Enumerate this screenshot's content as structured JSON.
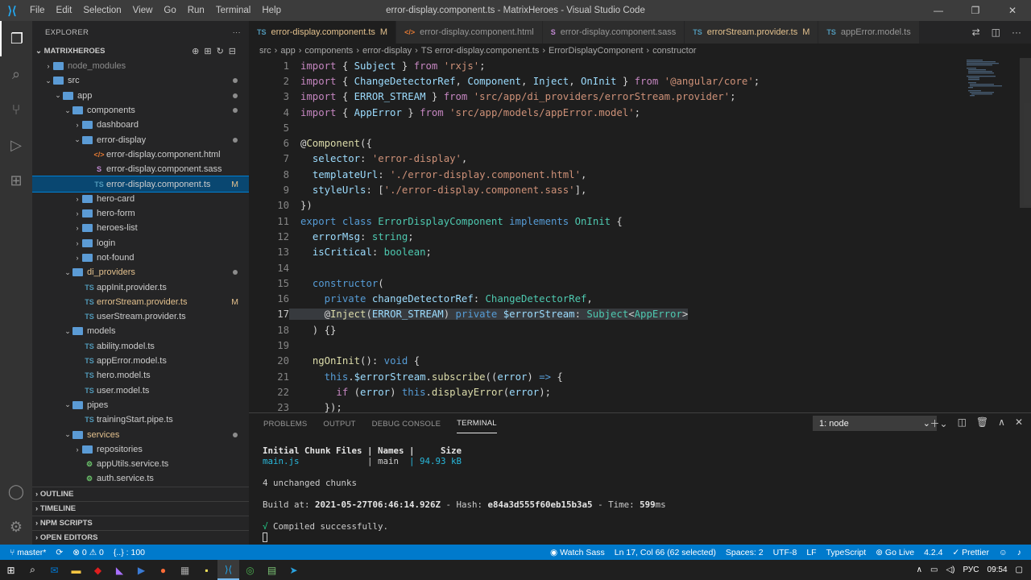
{
  "titlebar": {
    "menu": [
      "File",
      "Edit",
      "Selection",
      "View",
      "Go",
      "Run",
      "Terminal",
      "Help"
    ],
    "title": "error-display.component.ts - MatrixHeroes - Visual Studio Code"
  },
  "activity": [
    "files-icon",
    "search-icon",
    "source-control-icon",
    "run-debug-icon",
    "extensions-icon"
  ],
  "explorer": {
    "header": "EXPLORER",
    "root": "MATRIXHEROES",
    "tree": [
      {
        "label": "node_modules",
        "depth": 1,
        "kind": "folder",
        "open": false,
        "dim": true
      },
      {
        "label": "src",
        "depth": 1,
        "kind": "folder",
        "open": true,
        "dot": true
      },
      {
        "label": "app",
        "depth": 2,
        "kind": "folder",
        "open": true,
        "dot": true
      },
      {
        "label": "components",
        "depth": 3,
        "kind": "folder",
        "open": true,
        "dot": true
      },
      {
        "label": "dashboard",
        "depth": 4,
        "kind": "folder",
        "open": false
      },
      {
        "label": "error-display",
        "depth": 4,
        "kind": "folder",
        "open": true,
        "dot": true
      },
      {
        "label": "error-display.component.html",
        "depth": 5,
        "kind": "html"
      },
      {
        "label": "error-display.component.sass",
        "depth": 5,
        "kind": "sass"
      },
      {
        "label": "error-display.component.ts",
        "depth": 5,
        "kind": "ts",
        "selected": true,
        "mod": "M"
      },
      {
        "label": "hero-card",
        "depth": 4,
        "kind": "folder",
        "open": false
      },
      {
        "label": "hero-form",
        "depth": 4,
        "kind": "folder",
        "open": false
      },
      {
        "label": "heroes-list",
        "depth": 4,
        "kind": "folder",
        "open": false
      },
      {
        "label": "login",
        "depth": 4,
        "kind": "folder",
        "open": false
      },
      {
        "label": "not-found",
        "depth": 4,
        "kind": "folder",
        "open": false
      },
      {
        "label": "di_providers",
        "depth": 3,
        "kind": "folder",
        "open": true,
        "dot": true,
        "modified": true
      },
      {
        "label": "appInit.provider.ts",
        "depth": 4,
        "kind": "ts"
      },
      {
        "label": "errorStream.provider.ts",
        "depth": 4,
        "kind": "ts",
        "mod": "M",
        "modified": true
      },
      {
        "label": "userStream.provider.ts",
        "depth": 4,
        "kind": "ts"
      },
      {
        "label": "models",
        "depth": 3,
        "kind": "folder",
        "open": true
      },
      {
        "label": "ability.model.ts",
        "depth": 4,
        "kind": "ts"
      },
      {
        "label": "appError.model.ts",
        "depth": 4,
        "kind": "ts"
      },
      {
        "label": "hero.model.ts",
        "depth": 4,
        "kind": "ts"
      },
      {
        "label": "user.model.ts",
        "depth": 4,
        "kind": "ts"
      },
      {
        "label": "pipes",
        "depth": 3,
        "kind": "folder",
        "open": true
      },
      {
        "label": "trainingStart.pipe.ts",
        "depth": 4,
        "kind": "ts"
      },
      {
        "label": "services",
        "depth": 3,
        "kind": "folder",
        "open": true,
        "dot": true,
        "modified": true
      },
      {
        "label": "repositories",
        "depth": 4,
        "kind": "folder",
        "open": false
      },
      {
        "label": "appUtils.service.ts",
        "depth": 4,
        "kind": "svc"
      },
      {
        "label": "auth.service.ts",
        "depth": 4,
        "kind": "svc"
      }
    ],
    "sections": [
      "OUTLINE",
      "TIMELINE",
      "NPM SCRIPTS",
      "OPEN EDITORS"
    ]
  },
  "tabs": [
    {
      "icon": "TS",
      "label": "error-display.component.ts",
      "mod": "M",
      "active": true
    },
    {
      "icon": "</>",
      "label": "error-display.component.html"
    },
    {
      "icon": "S",
      "label": "error-display.component.sass"
    },
    {
      "icon": "TS",
      "label": "errorStream.provider.ts",
      "mod": "M"
    },
    {
      "icon": "TS",
      "label": "appError.model.ts"
    }
  ],
  "breadcrumb": [
    "src",
    "app",
    "components",
    "error-display",
    "TS error-display.component.ts",
    "ErrorDisplayComponent",
    "constructor"
  ],
  "code": [
    [
      [
        "kw",
        "import"
      ],
      [
        "p",
        " { "
      ],
      [
        "var",
        "Subject"
      ],
      [
        "p",
        " } "
      ],
      [
        "kw",
        "from"
      ],
      [
        "p",
        " "
      ],
      [
        "str",
        "'rxjs'"
      ],
      [
        "p",
        ";"
      ]
    ],
    [
      [
        "kw",
        "import"
      ],
      [
        "p",
        " { "
      ],
      [
        "var",
        "ChangeDetectorRef"
      ],
      [
        "p",
        ", "
      ],
      [
        "var",
        "Component"
      ],
      [
        "p",
        ", "
      ],
      [
        "var",
        "Inject"
      ],
      [
        "p",
        ", "
      ],
      [
        "var",
        "OnInit"
      ],
      [
        "p",
        " } "
      ],
      [
        "kw",
        "from"
      ],
      [
        "p",
        " "
      ],
      [
        "str",
        "'@angular/core'"
      ],
      [
        "p",
        ";"
      ]
    ],
    [
      [
        "kw",
        "import"
      ],
      [
        "p",
        " { "
      ],
      [
        "var",
        "ERROR_STREAM"
      ],
      [
        "p",
        " } "
      ],
      [
        "kw",
        "from"
      ],
      [
        "p",
        " "
      ],
      [
        "str",
        "'src/app/di_providers/errorStream.provider'"
      ],
      [
        "p",
        ";"
      ]
    ],
    [
      [
        "kw",
        "import"
      ],
      [
        "p",
        " { "
      ],
      [
        "var",
        "AppError"
      ],
      [
        "p",
        " } "
      ],
      [
        "kw",
        "from"
      ],
      [
        "p",
        " "
      ],
      [
        "str",
        "'src/app/models/appError.model'"
      ],
      [
        "p",
        ";"
      ]
    ],
    [],
    [
      [
        "p",
        "@"
      ],
      [
        "fn",
        "Component"
      ],
      [
        "p",
        "({"
      ]
    ],
    [
      [
        "p",
        "  "
      ],
      [
        "var",
        "selector"
      ],
      [
        "p",
        ": "
      ],
      [
        "str",
        "'error-display'"
      ],
      [
        "p",
        ","
      ]
    ],
    [
      [
        "p",
        "  "
      ],
      [
        "var",
        "templateUrl"
      ],
      [
        "p",
        ": "
      ],
      [
        "str",
        "'./error-display.component.html'"
      ],
      [
        "p",
        ","
      ]
    ],
    [
      [
        "p",
        "  "
      ],
      [
        "var",
        "styleUrls"
      ],
      [
        "p",
        ": ["
      ],
      [
        "str",
        "'./error-display.component.sass'"
      ],
      [
        "p",
        "],"
      ]
    ],
    [
      [
        "p",
        "})"
      ]
    ],
    [
      [
        "kw2",
        "export"
      ],
      [
        "p",
        " "
      ],
      [
        "kw2",
        "class"
      ],
      [
        "p",
        " "
      ],
      [
        "type",
        "ErrorDisplayComponent"
      ],
      [
        "p",
        " "
      ],
      [
        "kw2",
        "implements"
      ],
      [
        "p",
        " "
      ],
      [
        "type",
        "OnInit"
      ],
      [
        "p",
        " {"
      ]
    ],
    [
      [
        "p",
        "  "
      ],
      [
        "var",
        "errorMsg"
      ],
      [
        "p",
        ": "
      ],
      [
        "type",
        "string"
      ],
      [
        "p",
        ";"
      ]
    ],
    [
      [
        "p",
        "  "
      ],
      [
        "var",
        "isCritical"
      ],
      [
        "p",
        ": "
      ],
      [
        "type",
        "boolean"
      ],
      [
        "p",
        ";"
      ]
    ],
    [],
    [
      [
        "p",
        "  "
      ],
      [
        "kw2",
        "constructor"
      ],
      [
        "p",
        "("
      ]
    ],
    [
      [
        "p",
        "    "
      ],
      [
        "kw2",
        "private"
      ],
      [
        "p",
        " "
      ],
      [
        "var",
        "changeDetectorRef"
      ],
      [
        "p",
        ": "
      ],
      [
        "type",
        "ChangeDetectorRef"
      ],
      [
        "p",
        ","
      ]
    ],
    [
      [
        "p",
        "    @"
      ],
      [
        "fn",
        "Inject"
      ],
      [
        "p",
        "("
      ],
      [
        "var",
        "ERROR_STREAM"
      ],
      [
        "p",
        ") "
      ],
      [
        "kw2",
        "private"
      ],
      [
        "p",
        " "
      ],
      [
        "var",
        "$errorStream"
      ],
      [
        "p",
        ": "
      ],
      [
        "type",
        "Subject"
      ],
      [
        "p",
        "<"
      ],
      [
        "type",
        "AppError"
      ],
      [
        "p",
        ">"
      ]
    ],
    [
      [
        "p",
        "  ) {}"
      ]
    ],
    [],
    [
      [
        "p",
        "  "
      ],
      [
        "fn",
        "ngOnInit"
      ],
      [
        "p",
        "(): "
      ],
      [
        "kw2",
        "void"
      ],
      [
        "p",
        " {"
      ]
    ],
    [
      [
        "p",
        "    "
      ],
      [
        "kw2",
        "this"
      ],
      [
        "p",
        "."
      ],
      [
        "var",
        "$errorStream"
      ],
      [
        "p",
        "."
      ],
      [
        "fn",
        "subscribe"
      ],
      [
        "p",
        "(("
      ],
      [
        "var",
        "error"
      ],
      [
        "p",
        ") "
      ],
      [
        "kw2",
        "=>"
      ],
      [
        "p",
        " {"
      ]
    ],
    [
      [
        "p",
        "      "
      ],
      [
        "kw",
        "if"
      ],
      [
        "p",
        " ("
      ],
      [
        "var",
        "error"
      ],
      [
        "p",
        ") "
      ],
      [
        "kw2",
        "this"
      ],
      [
        "p",
        "."
      ],
      [
        "fn",
        "displayError"
      ],
      [
        "p",
        "("
      ],
      [
        "var",
        "error"
      ],
      [
        "p",
        ");"
      ]
    ],
    [
      [
        "p",
        "    });"
      ]
    ]
  ],
  "current_line": 17,
  "panel": {
    "tabs": [
      "PROBLEMS",
      "OUTPUT",
      "DEBUG CONSOLE",
      "TERMINAL"
    ],
    "active_tab": "TERMINAL",
    "terminal_select": "1: node",
    "lines": [
      {
        "t": "Initial Chunk Files | Names |     Size",
        "cls": "tb"
      },
      {
        "t": "main.js             | main  | 94.93 kB",
        "cls": "mixed"
      },
      {
        "t": "",
        "cls": ""
      },
      {
        "t": "4 unchanged chunks",
        "cls": ""
      },
      {
        "t": "",
        "cls": ""
      },
      {
        "t": "Build at: 2021-05-27T06:46:14.926Z - Hash: e84a3d555f60eb15b3a5 - Time: 599ms",
        "cls": "build"
      },
      {
        "t": "",
        "cls": ""
      },
      {
        "t": "√ Compiled successfully.",
        "cls": "ok"
      }
    ]
  },
  "statusbar": {
    "left": [
      "master*",
      "⟳",
      "⊗ 0 ⚠ 0",
      "{..} : 100"
    ],
    "right": [
      "Watch Sass",
      "Ln 17, Col 66 (62 selected)",
      "Spaces: 2",
      "UTF-8",
      "LF",
      "TypeScript",
      "Go Live",
      "4.2.4",
      "✓ Prettier"
    ]
  },
  "taskbar": {
    "lang": "РУС",
    "time": "09:54"
  },
  "colors": {
    "accent": "#007acc",
    "selected": "#094771",
    "modified": "#e2c08d"
  }
}
